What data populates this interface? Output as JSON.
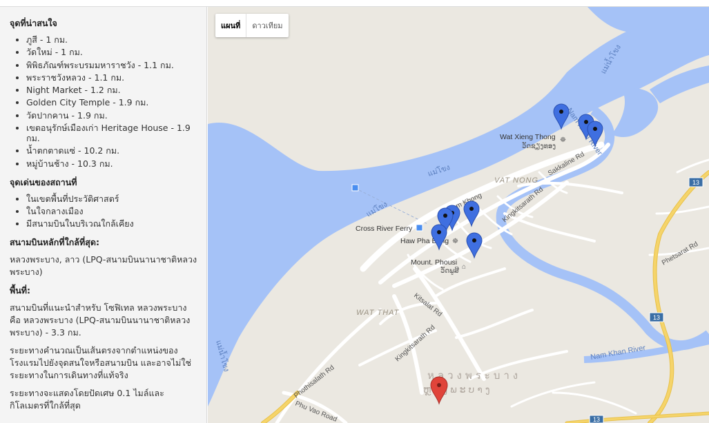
{
  "sidebar": {
    "attractions_heading": "จุดที่น่าสนใจ",
    "attractions": [
      "ภูสี - 1 กม.",
      "วัดใหม่ - 1 กม.",
      "พิพิธภัณฑ์พระบรมมหาราชวัง - 1.1 กม.",
      "พระราชวังหลวง - 1.1 กม.",
      "Night Market - 1.2 กม.",
      "Golden City Temple - 1.9 กม.",
      "วัดปากคาน - 1.9 กม.",
      "เขตอนุรักษ์เมืองเก่า Heritage House - 1.9 กม.",
      "น้ำตกตาดแซ่ - 10.2 กม.",
      "หมู่บ้านช้าง - 10.3 กม."
    ],
    "highlights_heading": "จุดเด่นของสถานที่",
    "highlights": [
      "ในเขตพื้นที่ประวัติศาสตร์",
      "ในใจกลางเมือง",
      "มีสนามบินในบริเวณใกล้เคียง"
    ],
    "airport_heading": "สนามบินหลักที่ใกล้ที่สุด:",
    "airport_text": "หลวงพระบาง, ลาว (LPQ-สนามบินนานาชาติหลวงพระบาง)",
    "area_heading": "พื้นที่:",
    "area_text": "สนามบินที่แนะนำสำหรับ โซฟิเทล หลวงพระบาง คือ หลวงพระบาง (LPQ-สนามบินนานาชาติหลวงพระบาง) - 3.3 กม.",
    "note1": "ระยะทางคำนวณเป็นเส้นตรงจากตำแหน่งของโรงแรมไปยังจุดสนใจหรือสนามบิน และอาจไม่ใช่ระยะทางในการเดินทางที่แท้จริง",
    "note2": "ระยะทางจะแสดงโดยปัดเศษ 0.1 ไมล์และกิโลเมตรที่ใกล้ที่สุด"
  },
  "map": {
    "type_buttons": {
      "map": "แผนที่",
      "satellite": "ดาวเทียม",
      "active": "map"
    },
    "labels": {
      "mekong1": "แม่น้ำโขง",
      "mekong2": "แม่โขง",
      "mekong3": "แม่น้ำโขง",
      "mekong4": "แม่โขง",
      "nam_khan_top": "Nam Khan River",
      "nam_khan_bottom": "Nam Khan River",
      "vat_nong": "VAT NONG",
      "wat_that": "WAT THAT",
      "wat_xieng_thong": "Wat Xieng Thong",
      "wat_xieng_thong_lao": "ວັດຊຽງທອງ",
      "cross_river_ferry": "Cross River Ferry",
      "haw_pha_bang": "Haw Pha Bang",
      "mount_phousi": "Mount. Phousi",
      "mount_phousi_lao": "ວັດພູສີ",
      "khem_khong": "Khem Khong",
      "sakkaline": "Sakkaline Rd",
      "kingkitsarath_top": "Kingkitsarath Rd",
      "kitsalat": "Kitsalat Rd",
      "kingkitsarath_low": "Kingkitsarath Rd",
      "phothisalath": "Phothisalath Rd",
      "phu_vao": "Phu Vao Road",
      "phetsarat": "Phetsarat Rd",
      "city_thai": "หลวงพระบาง",
      "city_lao": "ຫຼວງພະບາງ",
      "hw1": "13",
      "hw2": "13",
      "hw3": "13"
    },
    "colors": {
      "land": "#ebe8e1",
      "water": "#a5c2f7",
      "road": "#ffffff",
      "highway": "#f5d46a",
      "pin_blue": "#3f6fe0",
      "pin_red": "#e0443a"
    }
  }
}
